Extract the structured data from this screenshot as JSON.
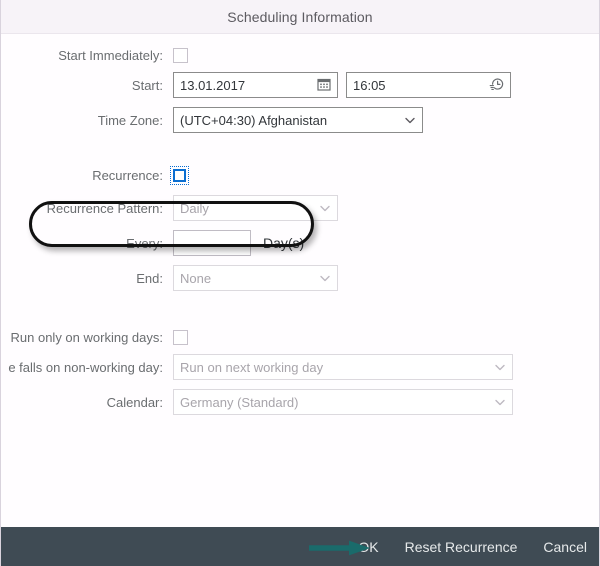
{
  "dialog": {
    "title": "Scheduling Information"
  },
  "form": {
    "start_immediately": {
      "label": "Start Immediately:",
      "checked": false,
      "icon": "checkbox-icon"
    },
    "start": {
      "label": "Start:",
      "date_value": "13.01.2017",
      "date_icon": "calendar-icon",
      "time_value": "16:05",
      "time_icon": "clock-history-icon"
    },
    "time_zone": {
      "label": "Time Zone:",
      "value": "(UTC+04:30) Afghanistan",
      "icon": "chevron-down-icon"
    },
    "recurrence": {
      "label": "Recurrence:",
      "checked": false,
      "focused": true,
      "icon": "checkbox-icon"
    },
    "recurrence_pattern": {
      "label": "Recurrence Pattern:",
      "value": "Daily",
      "icon": "chevron-down-icon",
      "disabled": true
    },
    "every": {
      "label": "Every:",
      "value": "",
      "suffix": "Day(s)"
    },
    "end": {
      "label": "End:",
      "value": "None",
      "icon": "chevron-down-icon",
      "disabled": true
    },
    "run_only_working_days": {
      "label": "Run only on working days:",
      "checked": false,
      "icon": "checkbox-icon"
    },
    "falls_on_non_working_day": {
      "label": "e falls on non-working day:",
      "value": "Run on next working day",
      "icon": "chevron-down-icon",
      "disabled": true
    },
    "calendar": {
      "label": "Calendar:",
      "value": "Germany (Standard)",
      "icon": "chevron-down-icon",
      "disabled": true
    }
  },
  "footer": {
    "ok_label": "OK",
    "reset_label": "Reset Recurrence",
    "cancel_label": "Cancel"
  },
  "annotations": {
    "highlight_ring": "recurrence-row-highlight",
    "arrow": "pointer-arrow-to-ok",
    "arrow_color": "#1a6b6b",
    "ring_color": "#111111"
  },
  "colors": {
    "accent": "#0a6ed1",
    "footer_bg": "#3f4b54",
    "title_bg": "#f7f3f8",
    "label_text": "#6a6d70"
  }
}
